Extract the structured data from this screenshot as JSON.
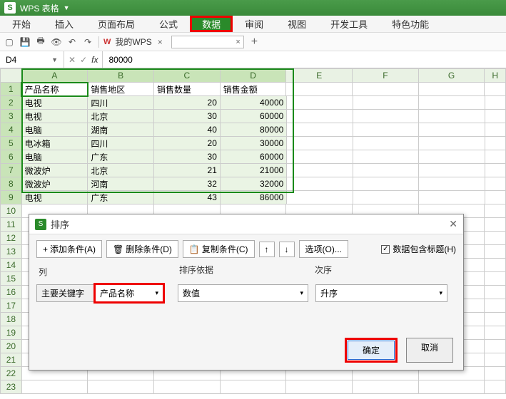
{
  "app": {
    "title": "WPS 表格",
    "logo": "S"
  },
  "menu": {
    "items": [
      "开始",
      "插入",
      "页面布局",
      "公式",
      "数据",
      "审阅",
      "视图",
      "开发工具",
      "特色功能"
    ],
    "active_index": 4
  },
  "toolbar": {
    "wps_label": "我的WPS",
    "tab_close": "×",
    "plus": "+"
  },
  "formula": {
    "namebox": "D4",
    "value": "80000"
  },
  "columns": [
    "A",
    "B",
    "C",
    "D",
    "E",
    "F",
    "G",
    "H"
  ],
  "rows": {
    "count": 23
  },
  "headers": [
    "产品名称",
    "销售地区",
    "销售数量",
    "销售金额"
  ],
  "table": [
    {
      "a": "电视",
      "b": "四川",
      "c": 20,
      "d": 40000
    },
    {
      "a": "电视",
      "b": "北京",
      "c": 30,
      "d": 60000
    },
    {
      "a": "电脑",
      "b": "湖南",
      "c": 40,
      "d": 80000
    },
    {
      "a": "电冰箱",
      "b": "四川",
      "c": 20,
      "d": 30000
    },
    {
      "a": "电脑",
      "b": "广东",
      "c": 30,
      "d": 60000
    },
    {
      "a": "微波炉",
      "b": "北京",
      "c": 21,
      "d": 21000
    },
    {
      "a": "微波炉",
      "b": "河南",
      "c": 32,
      "d": 32000
    },
    {
      "a": "电视",
      "b": "广东",
      "c": 43,
      "d": 86000
    }
  ],
  "dialog": {
    "title": "排序",
    "add_btn": "添加条件(A)",
    "del_btn": "删除条件(D)",
    "copy_btn": "复制条件(C)",
    "options_btn": "选项(O)...",
    "checkbox": "数据包含标题(H)",
    "col_header": "列",
    "basis_header": "排序依据",
    "order_header": "次序",
    "main_key_label": "主要关键字",
    "main_key_value": "产品名称",
    "basis_value": "数值",
    "order_value": "升序",
    "ok": "确定",
    "cancel": "取消"
  }
}
